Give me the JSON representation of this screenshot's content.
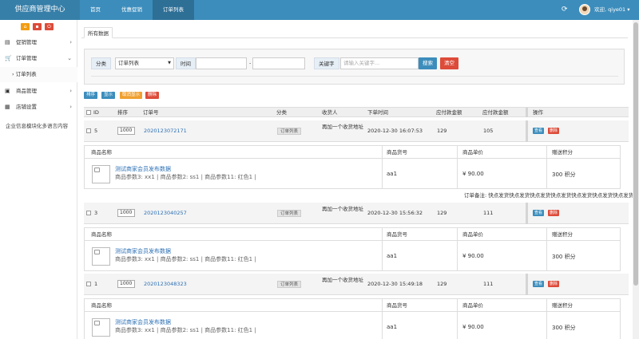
{
  "app": {
    "title": "供应商管理中心"
  },
  "nav": [
    "首页",
    "优惠促销",
    "订单列表"
  ],
  "header": {
    "welcome": "欢迎, qiye01 ▾"
  },
  "sidebar": {
    "menu": [
      {
        "label": "促销管理",
        "icon": "clipboard-icon"
      },
      {
        "label": "订单管理",
        "icon": "cart-icon"
      },
      {
        "label": "商品管理",
        "icon": "box-icon"
      },
      {
        "label": "店铺设置",
        "icon": "grid-icon"
      }
    ],
    "sub": "› 订单列表",
    "corp": "企业信息模块化多语言内容"
  },
  "tab": "所有数据",
  "filter": {
    "category_label": "分类",
    "category_value": "订单列表",
    "time_label": "时间",
    "time_sep": "-",
    "keyword_label": "关键字",
    "keyword_placeholder": "请输入关键字...",
    "search": "搜索",
    "clear": "清空"
  },
  "actions": [
    "排序",
    "显示",
    "取消显示",
    "删除"
  ],
  "columns": [
    "ID",
    "排序",
    "订单号",
    "分类",
    "收货人",
    "下单时间",
    "应付款金额",
    "应付款金额",
    "操作"
  ],
  "orders": [
    {
      "id": "5",
      "sort": "1000",
      "no": "2020123072171",
      "cat": "订单列表",
      "recv": "再加一个收货地址",
      "time": "2020-12-30 16:07:53",
      "pay1": "129",
      "pay2": "105"
    },
    {
      "id": "3",
      "sort": "1000",
      "no": "2020123040257",
      "cat": "订单列表",
      "recv": "再加一个收货地址",
      "time": "2020-12-30 15:56:32",
      "pay1": "129",
      "pay2": "111"
    },
    {
      "id": "1",
      "sort": "1000",
      "no": "2020123048323",
      "cat": "订单列表",
      "recv": "再加一个收货地址",
      "time": "2020-12-30 15:49:18",
      "pay1": "129",
      "pay2": "111"
    }
  ],
  "op": {
    "view": "查看",
    "del": "删除"
  },
  "goods_cols": [
    "商品名称",
    "商品货号",
    "商品单价",
    "赠送积分"
  ],
  "goods": {
    "name": "测试商家会员发布数据",
    "params": "商品参数3: xx1 | 商品参数2: ss1 | 商品参数11: 红色1 |",
    "sku": "aa1",
    "price": "¥ 90.00",
    "points": "300 积分"
  },
  "note": "订单备注: 快点发货快点发货快点发货快点发货快点发货快点发货快点发货快点发货快点发货快"
}
